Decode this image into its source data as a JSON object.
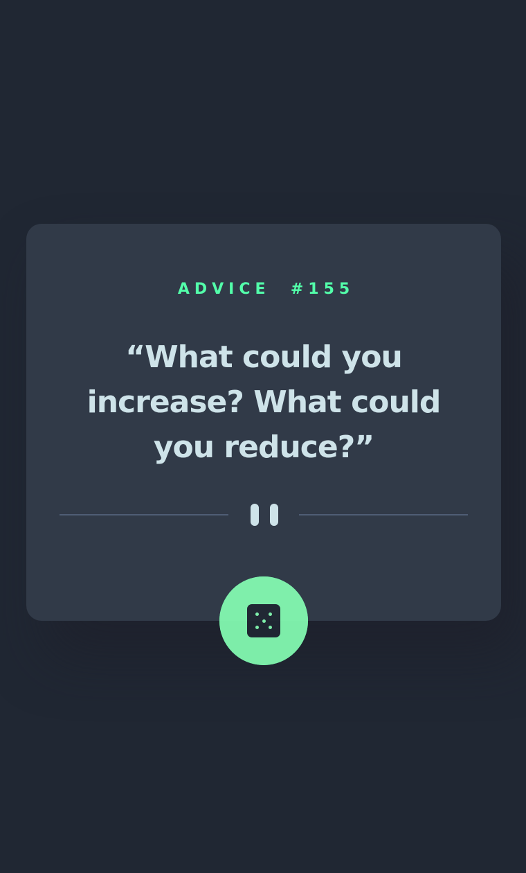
{
  "advice": {
    "label": "ADVICE",
    "number": "#155",
    "quote": "“What could you increase? What could you reduce?”"
  },
  "divider": {
    "icon": "pause-icon"
  },
  "dice_button": {
    "icon": "dice-icon"
  },
  "colors": {
    "background": "#202733",
    "card": "#313A48",
    "accent": "#53FFAA",
    "text": "#CEE3E9",
    "divider": "#4F5D74"
  }
}
